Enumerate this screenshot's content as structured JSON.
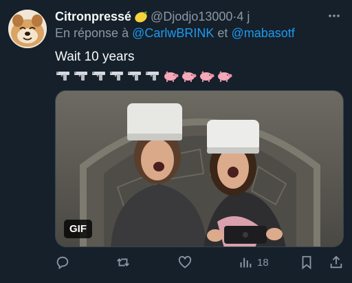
{
  "tweet": {
    "author_name": "Citronpressé",
    "author_handle": "@Djodjo13000",
    "separator": " · ",
    "timestamp": "4 j",
    "reply_prefix": "En réponse à",
    "mention1": "@CarlwBRINK",
    "reply_and": "et",
    "mention2": "@mabasotf",
    "text": "Wait 10 years",
    "emoji_sequence": [
      "gun",
      "gun",
      "gun",
      "gun",
      "gun",
      "gun",
      "pig",
      "pig",
      "pig",
      "pig"
    ],
    "gif_label": "GIF"
  },
  "actions": {
    "reply_icon": "reply-icon",
    "retweet_icon": "retweet-icon",
    "like_icon": "like-icon",
    "views_icon": "views-icon",
    "views_count": "18",
    "bookmark_icon": "bookmark-icon",
    "share_icon": "share-icon"
  },
  "colors": {
    "background": "#15202b",
    "muted": "#8b98a5",
    "link": "#1d9bf0",
    "text": "#f7f9f9"
  }
}
